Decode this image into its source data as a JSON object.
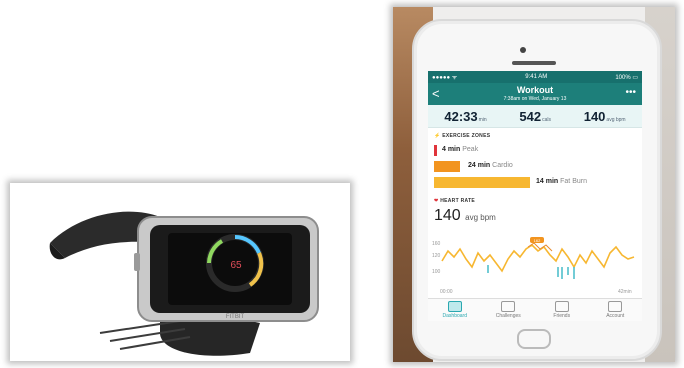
{
  "phone": {
    "status_carrier": "●●●●● ᯤ",
    "status_time": "9:41 AM",
    "status_battery": "100% ▭",
    "nav_back": "<",
    "title": "Workout",
    "subtitle": "7:38am on Wed, January 13",
    "nav_more": "•••",
    "stats": [
      {
        "value": "42:33",
        "unit": "min"
      },
      {
        "value": "542",
        "unit": "cals"
      },
      {
        "value": "140",
        "unit": "avg bpm"
      }
    ],
    "exercise_zones_label": "EXERCISE ZONES",
    "zones": [
      {
        "value": "4 min",
        "name": "Peak",
        "color": "#e0343b"
      },
      {
        "value": "24 min",
        "name": "Cardio",
        "color": "#f2941f"
      },
      {
        "value": "14 min",
        "name": "Fat Burn",
        "color": "#f7b731"
      }
    ],
    "heart_rate_label": "HEART RATE",
    "hr_value": "140",
    "hr_unit": "avg bpm",
    "chart": {
      "y_ticks": [
        "160",
        "120",
        "100"
      ],
      "x_start": "00:00",
      "x_end": "42min",
      "marker": "162"
    },
    "tabs": [
      "Dashboard",
      "Challenges",
      "Friends",
      "Account"
    ]
  },
  "watch": {
    "screen_value": "65",
    "brand": "FITBIT"
  }
}
